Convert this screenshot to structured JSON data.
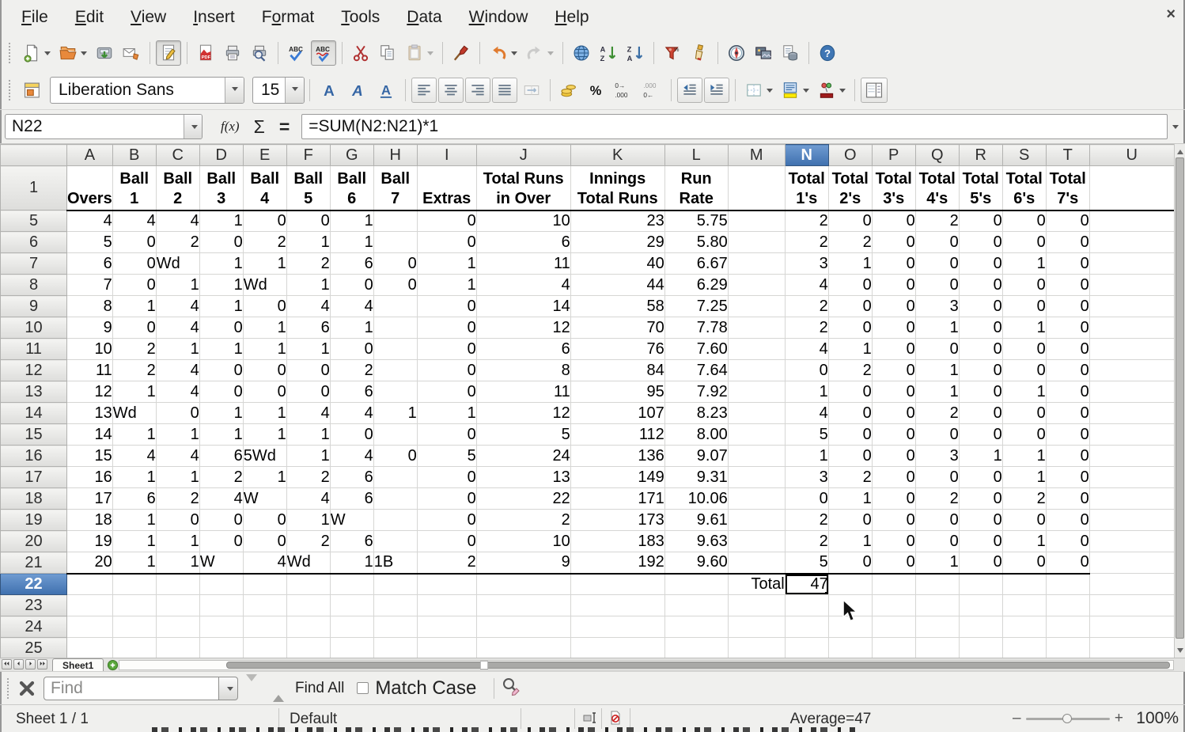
{
  "window": {
    "close_glyph": "×"
  },
  "menu": {
    "items": [
      {
        "label": "File",
        "accel": 0
      },
      {
        "label": "Edit",
        "accel": 0
      },
      {
        "label": "View",
        "accel": 0
      },
      {
        "label": "Insert",
        "accel": 0
      },
      {
        "label": "Format",
        "accel": 1
      },
      {
        "label": "Tools",
        "accel": 0
      },
      {
        "label": "Data",
        "accel": 0
      },
      {
        "label": "Window",
        "accel": 0
      },
      {
        "label": "Help",
        "accel": 0
      }
    ]
  },
  "standard_toolbar": {
    "icons": [
      {
        "name": "new-document-icon",
        "dropdown": true
      },
      {
        "name": "open-icon",
        "dropdown": true
      },
      {
        "name": "save-icon"
      },
      {
        "name": "email-icon"
      },
      {
        "separator": true
      },
      {
        "name": "edit-mode-icon",
        "pressed": true
      },
      {
        "separator": true
      },
      {
        "name": "export-pdf-icon"
      },
      {
        "name": "print-icon"
      },
      {
        "name": "print-preview-icon"
      },
      {
        "separator": true
      },
      {
        "name": "spelling-icon"
      },
      {
        "name": "auto-spellcheck-icon",
        "pressed": true
      },
      {
        "separator": true
      },
      {
        "name": "cut-icon"
      },
      {
        "name": "copy-icon"
      },
      {
        "name": "paste-icon",
        "dropdown": true,
        "disabled": true
      },
      {
        "separator": true
      },
      {
        "name": "clone-formatting-icon"
      },
      {
        "separator": true
      },
      {
        "name": "undo-icon",
        "dropdown": true
      },
      {
        "name": "redo-icon",
        "dropdown": true,
        "disabled": true
      },
      {
        "separator": true
      },
      {
        "name": "hyperlink-icon"
      },
      {
        "name": "sort-ascending-icon"
      },
      {
        "name": "sort-descending-icon"
      },
      {
        "separator": true
      },
      {
        "name": "autofilter-icon"
      },
      {
        "name": "format-paintbrush-icon"
      },
      {
        "separator": true
      },
      {
        "name": "navigator-icon"
      },
      {
        "name": "gallery-icon"
      },
      {
        "name": "data-sources-icon"
      },
      {
        "separator": true
      },
      {
        "name": "help-icon"
      }
    ]
  },
  "formatting_toolbar": {
    "font_name": "Liberation Sans",
    "font_size": "15",
    "icons": [
      {
        "name": "bold-icon"
      },
      {
        "name": "italic-icon"
      },
      {
        "name": "underline-icon"
      },
      {
        "separator": true
      },
      {
        "name": "align-left-icon",
        "framed": true
      },
      {
        "name": "align-center-icon",
        "framed": true
      },
      {
        "name": "align-right-icon",
        "framed": true
      },
      {
        "name": "align-justify-icon",
        "framed": true
      },
      {
        "name": "merge-cells-icon",
        "disabled": true
      },
      {
        "separator": true
      },
      {
        "name": "currency-icon"
      },
      {
        "name": "percent-icon"
      },
      {
        "name": "add-decimal-icon"
      },
      {
        "name": "delete-decimal-icon"
      },
      {
        "separator": true
      },
      {
        "name": "decrease-indent-icon",
        "framed": true
      },
      {
        "name": "increase-indent-icon",
        "framed": true
      },
      {
        "separator": true
      },
      {
        "name": "borders-icon",
        "dropdown": true
      },
      {
        "name": "background-color-icon",
        "dropdown": true
      },
      {
        "name": "font-color-icon",
        "dropdown": true
      },
      {
        "separator": true
      },
      {
        "name": "sidebar-icon",
        "framed": true
      }
    ]
  },
  "formula_bar": {
    "cell_reference": "N22",
    "fx_label": "f(x)",
    "sum_label": "Σ",
    "equals_label": "=",
    "formula": "=SUM(N2:N21)*1"
  },
  "grid": {
    "columns": [
      "A",
      "B",
      "C",
      "D",
      "E",
      "F",
      "G",
      "H",
      "I",
      "J",
      "K",
      "L",
      "M",
      "N",
      "O",
      "P",
      "Q",
      "R",
      "S",
      "T",
      "U"
    ],
    "selected_column": "N",
    "selected_row": 22,
    "selected_cell": "N22",
    "header_row": {
      "num": 1,
      "cells": {
        "A": [
          "Overs"
        ],
        "B": [
          "Ball",
          "1"
        ],
        "C": [
          "Ball",
          "2"
        ],
        "D": [
          "Ball",
          "3"
        ],
        "E": [
          "Ball",
          "4"
        ],
        "F": [
          "Ball",
          "5"
        ],
        "G": [
          "Ball",
          "6"
        ],
        "H": [
          "Ball",
          "7"
        ],
        "I": [
          "Extras"
        ],
        "J": [
          "Total Runs",
          "in Over"
        ],
        "K": [
          "Innings",
          "Total Runs"
        ],
        "L": [
          "Run",
          "Rate"
        ],
        "M": [],
        "N": [
          "Total",
          "1's"
        ],
        "O": [
          "Total",
          "2's"
        ],
        "P": [
          "Total",
          "3's"
        ],
        "Q": [
          "Total",
          "4's"
        ],
        "R": [
          "Total",
          "5's"
        ],
        "S": [
          "Total",
          "6's"
        ],
        "T": [
          "Total",
          "7's"
        ],
        "U": []
      }
    },
    "rows": [
      {
        "num": 5,
        "cells": [
          "4",
          "4",
          "4",
          "1",
          "0",
          "0",
          "1",
          "",
          "0",
          "10",
          "23",
          "5.75",
          "",
          "2",
          "0",
          "0",
          "2",
          "0",
          "0",
          "0",
          ""
        ]
      },
      {
        "num": 6,
        "cells": [
          "5",
          "0",
          "2",
          "0",
          "2",
          "1",
          "1",
          "",
          "0",
          "6",
          "29",
          "5.80",
          "",
          "2",
          "2",
          "0",
          "0",
          "0",
          "0",
          "0",
          ""
        ]
      },
      {
        "num": 7,
        "cells": [
          "6",
          "0",
          "Wd",
          "1",
          "1",
          "2",
          "6",
          "0",
          "1",
          "11",
          "40",
          "6.67",
          "",
          "3",
          "1",
          "0",
          "0",
          "0",
          "1",
          "0",
          ""
        ]
      },
      {
        "num": 8,
        "cells": [
          "7",
          "0",
          "1",
          "1",
          "Wd",
          "1",
          "0",
          "0",
          "1",
          "4",
          "44",
          "6.29",
          "",
          "4",
          "0",
          "0",
          "0",
          "0",
          "0",
          "0",
          ""
        ]
      },
      {
        "num": 9,
        "cells": [
          "8",
          "1",
          "4",
          "1",
          "0",
          "4",
          "4",
          "",
          "0",
          "14",
          "58",
          "7.25",
          "",
          "2",
          "0",
          "0",
          "3",
          "0",
          "0",
          "0",
          ""
        ]
      },
      {
        "num": 10,
        "cells": [
          "9",
          "0",
          "4",
          "0",
          "1",
          "6",
          "1",
          "",
          "0",
          "12",
          "70",
          "7.78",
          "",
          "2",
          "0",
          "0",
          "1",
          "0",
          "1",
          "0",
          ""
        ]
      },
      {
        "num": 11,
        "cells": [
          "10",
          "2",
          "1",
          "1",
          "1",
          "1",
          "0",
          "",
          "0",
          "6",
          "76",
          "7.60",
          "",
          "4",
          "1",
          "0",
          "0",
          "0",
          "0",
          "0",
          ""
        ]
      },
      {
        "num": 12,
        "cells": [
          "11",
          "2",
          "4",
          "0",
          "0",
          "0",
          "2",
          "",
          "0",
          "8",
          "84",
          "7.64",
          "",
          "0",
          "2",
          "0",
          "1",
          "0",
          "0",
          "0",
          ""
        ]
      },
      {
        "num": 13,
        "cells": [
          "12",
          "1",
          "4",
          "0",
          "0",
          "0",
          "6",
          "",
          "0",
          "11",
          "95",
          "7.92",
          "",
          "1",
          "0",
          "0",
          "1",
          "0",
          "1",
          "0",
          ""
        ]
      },
      {
        "num": 14,
        "cells": [
          "13",
          "Wd",
          "0",
          "1",
          "1",
          "4",
          "4",
          "1",
          "1",
          "12",
          "107",
          "8.23",
          "",
          "4",
          "0",
          "0",
          "2",
          "0",
          "0",
          "0",
          ""
        ]
      },
      {
        "num": 15,
        "cells": [
          "14",
          "1",
          "1",
          "1",
          "1",
          "1",
          "0",
          "",
          "0",
          "5",
          "112",
          "8.00",
          "",
          "5",
          "0",
          "0",
          "0",
          "0",
          "0",
          "0",
          ""
        ]
      },
      {
        "num": 16,
        "cells": [
          "15",
          "4",
          "4",
          "6",
          "5Wd",
          "1",
          "4",
          "0",
          "5",
          "24",
          "136",
          "9.07",
          "",
          "1",
          "0",
          "0",
          "3",
          "1",
          "1",
          "0",
          ""
        ]
      },
      {
        "num": 17,
        "cells": [
          "16",
          "1",
          "1",
          "2",
          "1",
          "2",
          "6",
          "",
          "0",
          "13",
          "149",
          "9.31",
          "",
          "3",
          "2",
          "0",
          "0",
          "0",
          "1",
          "0",
          ""
        ]
      },
      {
        "num": 18,
        "cells": [
          "17",
          "6",
          "2",
          "4",
          "W",
          "4",
          "6",
          "",
          "0",
          "22",
          "171",
          "10.06",
          "",
          "0",
          "1",
          "0",
          "2",
          "0",
          "2",
          "0",
          ""
        ]
      },
      {
        "num": 19,
        "cells": [
          "18",
          "1",
          "0",
          "0",
          "0",
          "1",
          "W",
          "",
          "0",
          "2",
          "173",
          "9.61",
          "",
          "2",
          "0",
          "0",
          "0",
          "0",
          "0",
          "0",
          ""
        ]
      },
      {
        "num": 20,
        "cells": [
          "19",
          "1",
          "1",
          "0",
          "0",
          "2",
          "6",
          "",
          "0",
          "10",
          "183",
          "9.63",
          "",
          "2",
          "1",
          "0",
          "0",
          "0",
          "1",
          "0",
          ""
        ]
      },
      {
        "num": 21,
        "cells": [
          "20",
          "1",
          "1",
          "W",
          "4",
          "Wd",
          "1",
          "1B",
          "2",
          "9",
          "192",
          "9.60",
          "",
          "5",
          "0",
          "0",
          "1",
          "0",
          "0",
          "0",
          ""
        ],
        "bold_cols": [
          "K"
        ],
        "bottom_border": true
      },
      {
        "num": 22,
        "cells": [
          "",
          "",
          "",
          "",
          "",
          "",
          "",
          "",
          "",
          "",
          "",
          "",
          "Total",
          "47",
          "",
          "",
          "",
          "",
          "",
          "",
          ""
        ],
        "bold_cols": [
          "M"
        ],
        "align_overrides": {
          "M": "right"
        }
      },
      {
        "num": 23,
        "cells": [
          "",
          "",
          "",
          "",
          "",
          "",
          "",
          "",
          "",
          "",
          "",
          "",
          "",
          "",
          "",
          "",
          "",
          "",
          "",
          "",
          ""
        ]
      },
      {
        "num": 24,
        "cells": [
          "",
          "",
          "",
          "",
          "",
          "",
          "",
          "",
          "",
          "",
          "",
          "",
          "",
          "",
          "",
          "",
          "",
          "",
          "",
          "",
          ""
        ]
      },
      {
        "num": 25,
        "cells": [
          "",
          "",
          "",
          "",
          "",
          "",
          "",
          "",
          "",
          "",
          "",
          "",
          "",
          "",
          "",
          "",
          "",
          "",
          "",
          "",
          ""
        ]
      }
    ]
  },
  "sheet_tabs": {
    "active": "Sheet1",
    "nav_icons": [
      "first-sheet-icon",
      "previous-sheet-icon",
      "next-sheet-icon",
      "last-sheet-icon"
    ],
    "add_icon": "add-sheet-icon"
  },
  "find_bar": {
    "placeholder": "Find",
    "find_all_label": "Find All",
    "match_case_label": "Match Case",
    "match_case_checked": false
  },
  "status_bar": {
    "sheet_info": "Sheet 1 / 1",
    "page_style": "Default",
    "summary": "Average=47",
    "zoom_minus": "–",
    "zoom_plus": "+",
    "zoom_level": "100%"
  }
}
